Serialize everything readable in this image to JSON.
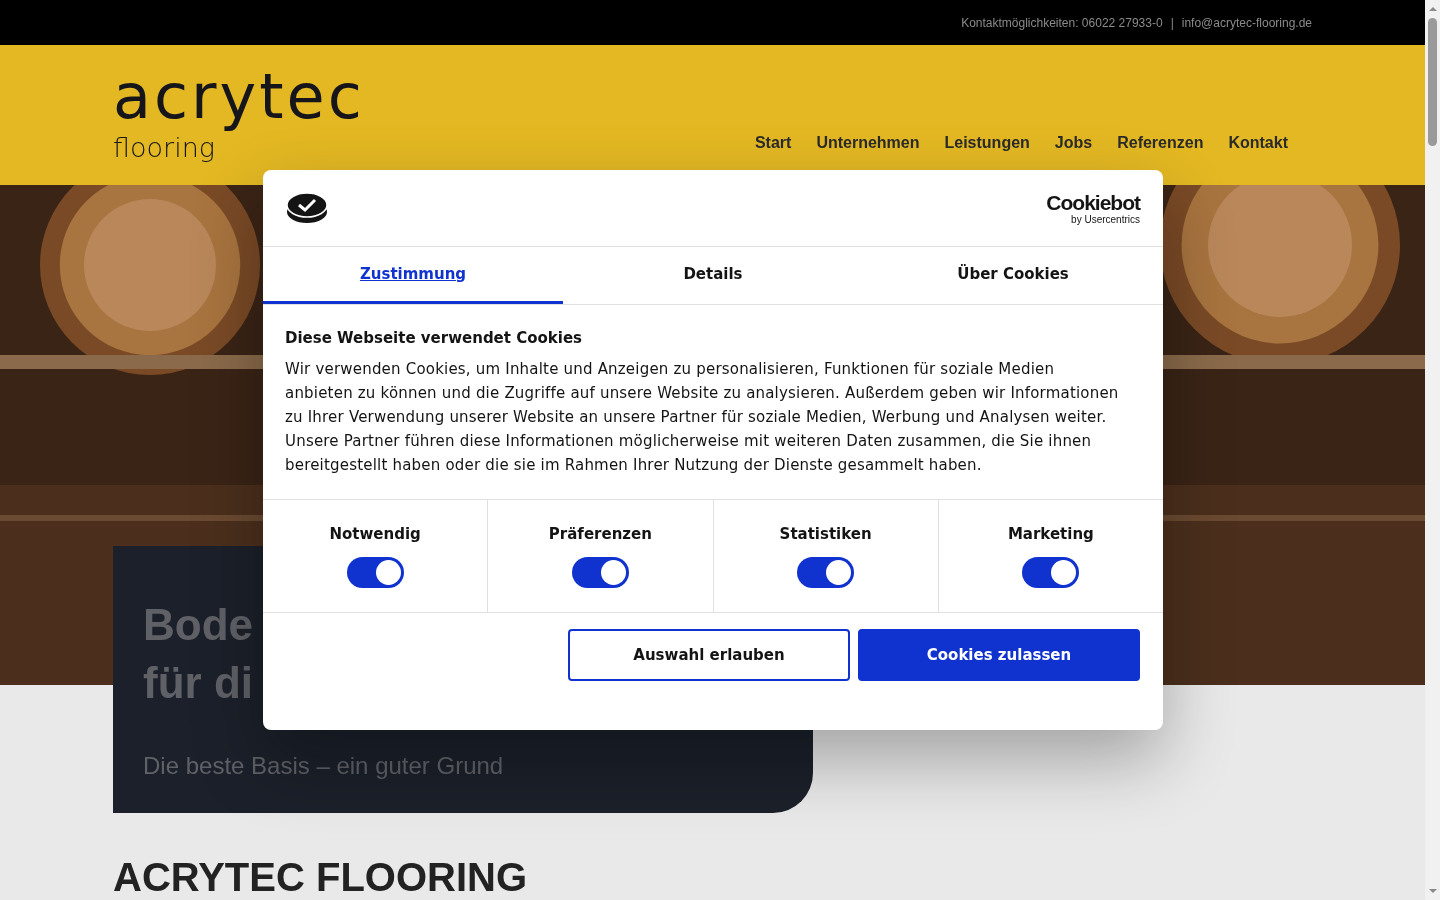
{
  "top_bar": {
    "contact": "Kontaktmöglichkeiten: 06022 27933-0",
    "separator": "|",
    "email": "info@acrytec-flooring.de"
  },
  "header": {
    "logo_main": "acrytec",
    "logo_sub": "flooring",
    "nav": [
      {
        "label": "Start",
        "selected": false
      },
      {
        "label": "Unternehmen",
        "selected": false
      },
      {
        "label": "Leistungen",
        "selected": false
      },
      {
        "label": "Jobs",
        "selected": false
      },
      {
        "label": "Referenzen",
        "selected": false
      },
      {
        "label": "Kontakt",
        "selected": false
      }
    ]
  },
  "hero": {
    "picture": {
      "kind": "picture"
    },
    "headline_lines": [
      "Bode",
      "für di"
    ],
    "subline": "Die beste Basis – ein guter Grund"
  },
  "section": {
    "heading": "ACRYTEC FLOORING"
  },
  "cookie_dialog": {
    "brand": "Cookiebot",
    "brand_sub": "by Usercentrics",
    "tabs": [
      {
        "label": "Zustimmung",
        "selected": true
      },
      {
        "label": "Details",
        "selected": false
      },
      {
        "label": "Über Cookies",
        "selected": false
      }
    ],
    "title": "Diese Webseite verwendet Cookies",
    "text": "Wir verwenden Cookies, um Inhalte und Anzeigen zu personalisieren, Funktionen für soziale Medien anbieten zu können und die Zugriffe auf unsere Website zu analysieren. Außerdem geben wir Informationen zu Ihrer Verwendung unserer Website an unsere Partner für soziale Medien, Werbung und Analysen weiter. Unsere Partner führen diese Informationen möglicherweise mit weiteren Daten zusammen, die Sie ihnen bereitgestellt haben oder die sie im Rahmen Ihrer Nutzung der Dienste gesammelt haben.",
    "categories": [
      {
        "label": "Notwendig",
        "on": true
      },
      {
        "label": "Präferenzen",
        "on": true
      },
      {
        "label": "Statistiken",
        "on": true
      },
      {
        "label": "Marketing",
        "on": true
      }
    ],
    "buttons": [
      {
        "label": "Auswahl erlauben",
        "kind": "outline"
      },
      {
        "label": "Cookies zulassen",
        "kind": "primary"
      }
    ]
  }
}
